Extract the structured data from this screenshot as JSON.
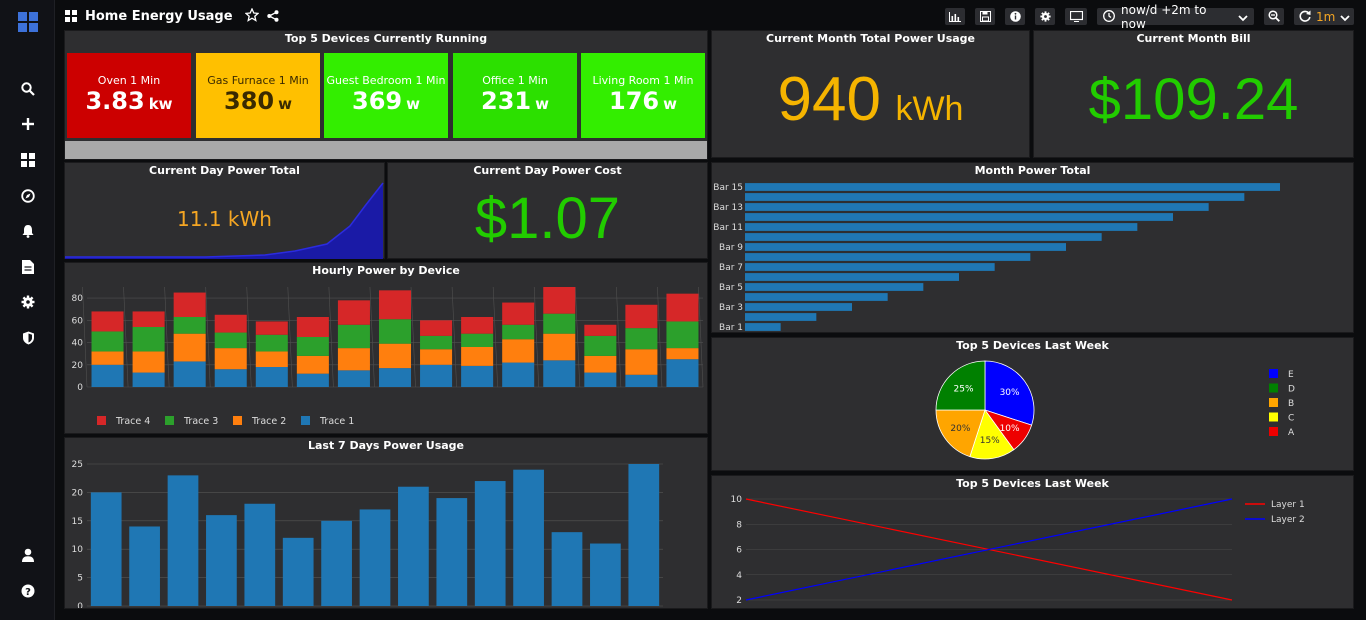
{
  "dashboard": {
    "title": "Home Energy Usage",
    "time_range": "now/d +2m to now",
    "refresh": "1m"
  },
  "icons": {
    "sidebar": [
      "grafana-logo-icon",
      "search-icon",
      "plus-icon",
      "dashboards-icon",
      "explore-icon",
      "alerting-icon",
      "reports-icon",
      "settings-gear-icon",
      "shield-icon",
      "user-icon",
      "help-icon"
    ],
    "toolbar": [
      "add-panel-icon",
      "save-icon",
      "info-icon",
      "settings-icon",
      "tv-mode-icon",
      "clock-icon",
      "zoom-out-icon",
      "refresh-icon"
    ]
  },
  "top5_running": {
    "title": "Top 5 Devices Currently Running",
    "tiles": [
      {
        "name": "Oven 1 Min",
        "value": "3.83",
        "unit": "kw",
        "color": "#cc0000"
      },
      {
        "name": "Gas Furnace 1 Min",
        "value": "380",
        "unit": "w",
        "color": "#ffc000"
      },
      {
        "name": "Guest Bedroom 1 Min",
        "value": "369",
        "unit": "w",
        "color": "#33ee00"
      },
      {
        "name": "Office 1 Min",
        "value": "231",
        "unit": "w",
        "color": "#2ce000"
      },
      {
        "name": "Living Room 1 Min",
        "value": "176",
        "unit": "w",
        "color": "#33ee00"
      }
    ]
  },
  "month_total": {
    "title": "Current Month Total Power Usage",
    "value": "940",
    "unit": "kWh",
    "color": "#f5b400"
  },
  "month_bill": {
    "title": "Current Month Bill",
    "value": "$109.24",
    "color": "#22cc00"
  },
  "day_total": {
    "title": "Current Day Power Total",
    "value": "11.1 kWh",
    "color": "#f5a623"
  },
  "day_cost": {
    "title": "Current Day Power Cost",
    "value": "$1.07",
    "color": "#22cc00"
  },
  "chart_data": [
    {
      "title": "Hourly Power by Device",
      "type": "bar",
      "stacked": true,
      "ylim": [
        0,
        90
      ],
      "yticks": [
        0,
        20,
        40,
        60,
        80
      ],
      "legend_position": "bottom-left",
      "series": [
        {
          "name": "Trace 1",
          "color": "#1f77b4",
          "values": [
            20,
            13,
            23,
            16,
            18,
            12,
            15,
            17,
            20,
            19,
            22,
            24,
            13,
            11,
            25
          ]
        },
        {
          "name": "Trace 2",
          "color": "#ff7f0e",
          "values": [
            12,
            19,
            25,
            19,
            14,
            16,
            20,
            22,
            14,
            17,
            21,
            24,
            15,
            23,
            10
          ]
        },
        {
          "name": "Trace 3",
          "color": "#2ca02c",
          "values": [
            18,
            22,
            15,
            14,
            15,
            17,
            21,
            22,
            12,
            12,
            13,
            18,
            18,
            19,
            24
          ]
        },
        {
          "name": "Trace 4",
          "color": "#d62728",
          "values": [
            18,
            14,
            22,
            16,
            12,
            18,
            22,
            26,
            14,
            15,
            20,
            24,
            10,
            21,
            25
          ]
        }
      ]
    },
    {
      "title": "Last 7 Days Power Usage",
      "type": "bar",
      "ylim": [
        0,
        25
      ],
      "yticks": [
        0,
        5,
        10,
        15,
        20,
        25
      ],
      "color": "#1f77b4",
      "values": [
        20,
        14,
        23,
        16,
        18,
        12,
        15,
        17,
        21,
        19,
        22,
        24,
        13,
        11,
        25
      ]
    },
    {
      "title": "Month Power Total",
      "type": "bar",
      "orientation": "horizontal",
      "color": "#1f77b4",
      "categories": [
        "Bar 1",
        "Bar 2",
        "Bar 3",
        "Bar 4",
        "Bar 5",
        "Bar 6",
        "Bar 7",
        "Bar 8",
        "Bar 9",
        "Bar 10",
        "Bar 11",
        "Bar 12",
        "Bar 13",
        "Bar 14",
        "Bar 15"
      ],
      "shown_labels": [
        "Bar 1",
        "Bar 3",
        "Bar 5",
        "Bar 7",
        "Bar 9",
        "Bar 11",
        "Bar 13",
        "Bar 15"
      ],
      "values": [
        1,
        2,
        3,
        4,
        5,
        6,
        7,
        8,
        9,
        10,
        11,
        12,
        13,
        14,
        15
      ]
    },
    {
      "title": "Top 5 Devices Last Week",
      "type": "pie",
      "legend_position": "right",
      "slices": [
        {
          "label": "E",
          "value": 30,
          "color": "#0000ff"
        },
        {
          "label": "A",
          "value": 10,
          "color": "#ee0000"
        },
        {
          "label": "C",
          "value": 15,
          "color": "#ffff00"
        },
        {
          "label": "B",
          "value": 20,
          "color": "#ffa500"
        },
        {
          "label": "D",
          "value": 25,
          "color": "#008000"
        }
      ],
      "legend_order": [
        "E",
        "D",
        "B",
        "C",
        "A"
      ]
    },
    {
      "title": "Top 5 Devices Last Week",
      "type": "line",
      "ylim": [
        2,
        10
      ],
      "yticks": [
        2,
        4,
        6,
        8,
        10
      ],
      "legend_position": "top-right",
      "series": [
        {
          "name": "Layer 1",
          "color": "#ff0000",
          "x": [
            0,
            1
          ],
          "y": [
            10,
            2
          ]
        },
        {
          "name": "Layer 2",
          "color": "#0000ff",
          "x": [
            0,
            1
          ],
          "y": [
            2,
            10
          ]
        }
      ]
    }
  ]
}
